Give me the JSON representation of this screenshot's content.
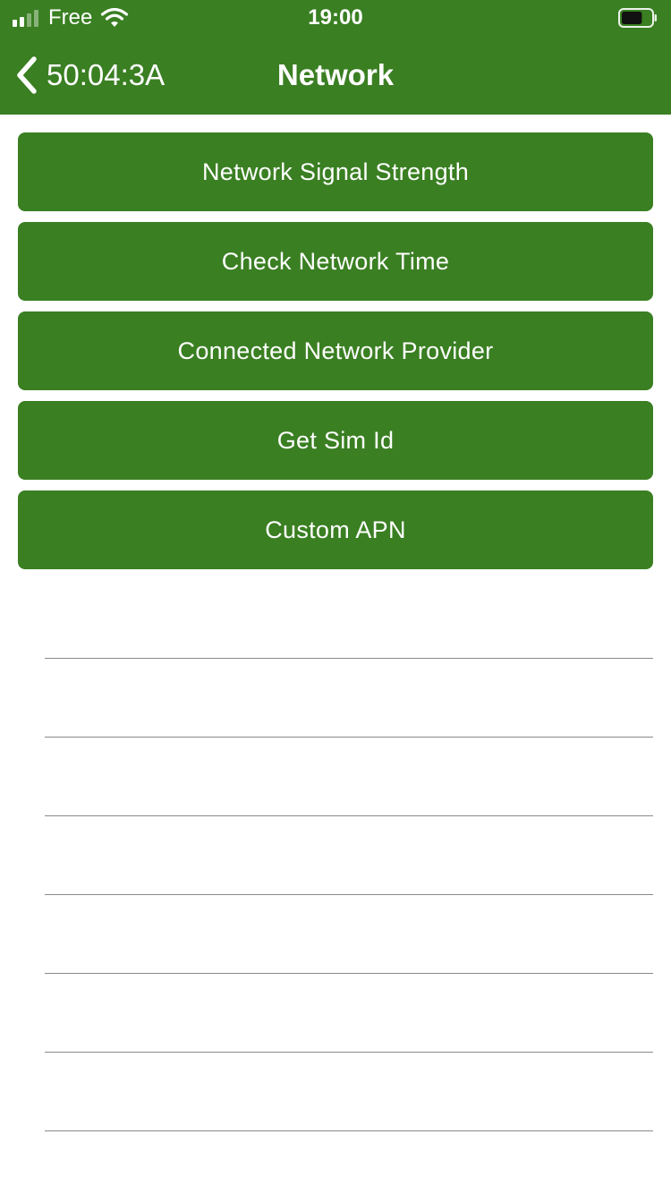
{
  "status_bar": {
    "carrier": "Free",
    "time": "19:00",
    "signal_bars": 4,
    "signal_bars_filled": 2,
    "battery_level": 0.7,
    "icons": [
      "signal-icon",
      "wifi-icon",
      "battery-icon"
    ]
  },
  "nav": {
    "back_label": "50:04:3A",
    "title": "Network",
    "back_icon": "chevron-left-icon"
  },
  "actions": [
    {
      "label": "Network Signal Strength"
    },
    {
      "label": "Check Network Time"
    },
    {
      "label": "Connected Network Provider"
    },
    {
      "label": "Get Sim Id"
    },
    {
      "label": "Custom APN"
    }
  ],
  "results_list": {
    "row_count": 7
  },
  "colors": {
    "brand": "#3a7f22",
    "text_on_brand": "#ffffff",
    "background": "#ffffff",
    "separator": "#8a8a8a"
  }
}
